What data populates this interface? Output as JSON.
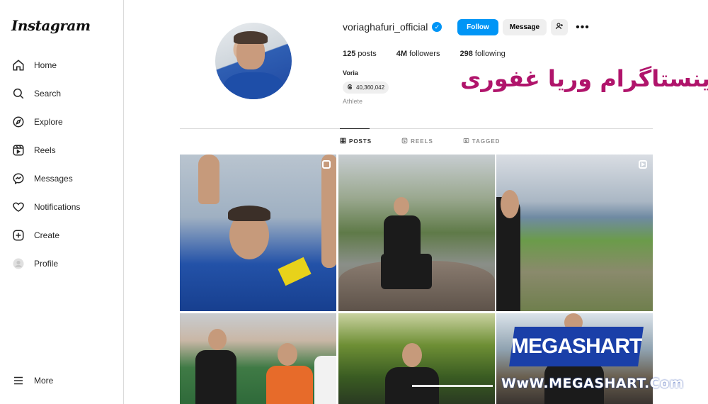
{
  "app": {
    "logo_text": "Instagram"
  },
  "sidebar": {
    "items": [
      {
        "label": "Home",
        "icon": "home-icon"
      },
      {
        "label": "Search",
        "icon": "search-icon"
      },
      {
        "label": "Explore",
        "icon": "compass-icon"
      },
      {
        "label": "Reels",
        "icon": "reels-icon"
      },
      {
        "label": "Messages",
        "icon": "messenger-icon"
      },
      {
        "label": "Notifications",
        "icon": "heart-icon"
      },
      {
        "label": "Create",
        "icon": "plus-square-icon"
      },
      {
        "label": "Profile",
        "icon": "avatar-icon"
      }
    ],
    "more_label": "More"
  },
  "profile": {
    "username": "voriaghafuri_official",
    "verified": true,
    "follow_label": "Follow",
    "message_label": "Message",
    "stats": {
      "posts_count": "125",
      "posts_label": "posts",
      "followers_count": "4M",
      "followers_label": "followers",
      "following_count": "298",
      "following_label": "following"
    },
    "full_name": "Voria",
    "threads_count": "40,360,042",
    "category": "Athlete"
  },
  "overlay": {
    "persian_title": "اینستاگرام وریا غفوری",
    "mega_brand": "MEGASHART",
    "mega_url": "WwW.MEGASHART.Com"
  },
  "tabs": [
    {
      "label": "POSTS",
      "icon": "grid-icon",
      "active": true
    },
    {
      "label": "REELS",
      "icon": "reels-icon",
      "active": false
    },
    {
      "label": "TAGGED",
      "icon": "tag-icon",
      "active": false
    }
  ],
  "colors": {
    "accent": "#0095f6",
    "watermark": "#b0146b",
    "brand_blue": "#1a3fa8"
  }
}
